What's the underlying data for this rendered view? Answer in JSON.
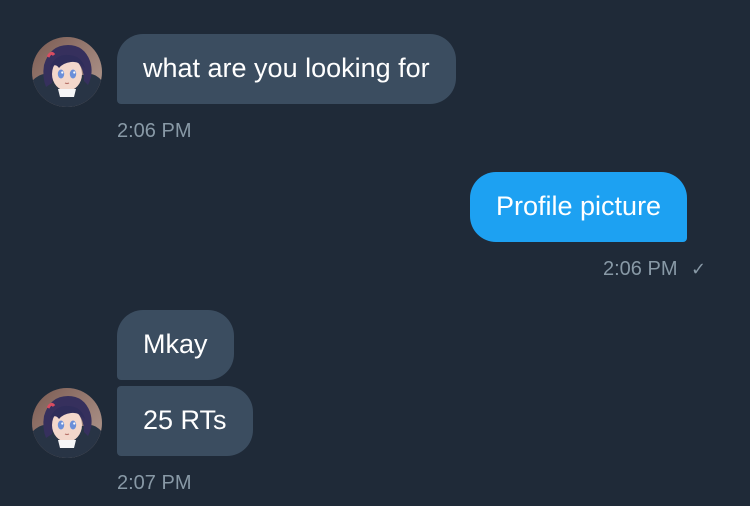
{
  "conversation": {
    "messages": [
      {
        "direction": "incoming",
        "text": "what are you looking for"
      },
      {
        "direction": "outgoing",
        "text": "Profile picture"
      },
      {
        "direction": "incoming",
        "text": "Mkay"
      },
      {
        "direction": "incoming",
        "text": "25 RTs"
      }
    ],
    "timestamps": [
      "2:06 PM",
      "2:06 PM",
      "2:07 PM"
    ],
    "read_receipt_icon": "checkmark-icon",
    "avatar_icon": "anime-avatar"
  },
  "colors": {
    "background": "#1f2a38",
    "incoming_bubble": "#3b4d60",
    "outgoing_bubble": "#1da1f2",
    "timestamp_text": "#8899a6",
    "message_text": "#ffffff"
  }
}
